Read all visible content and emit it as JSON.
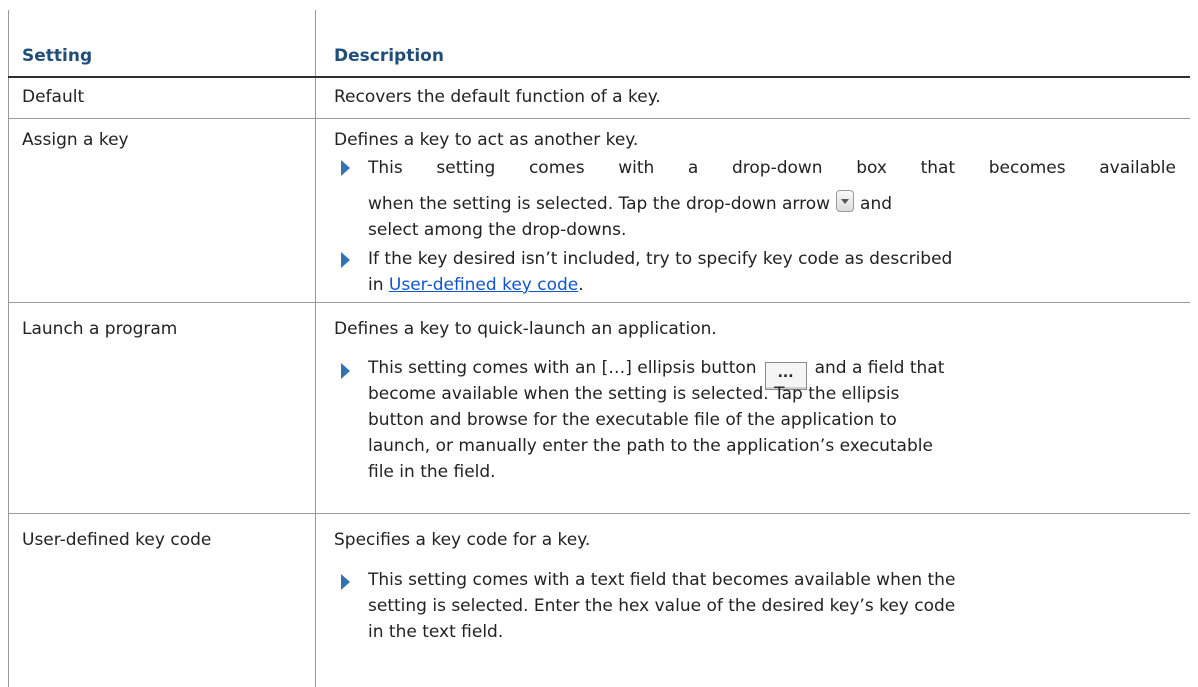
{
  "header": {
    "setting": "Setting",
    "description": "Description"
  },
  "rows": [
    {
      "setting": "Default",
      "description": "Recovers the default function of a key."
    },
    {
      "setting": "Assign a key",
      "description": "Defines a key to act as another key.",
      "bullet1_a": "This setting comes with a drop-down box that becomes available",
      "bullet1_b": "when the setting is selected. Tap the drop-down arrow",
      "bullet1_c": "and",
      "bullet1_d": "select among the drop-downs.",
      "bullet2_a": "If the key desired isn’t included, try to specify key code as described",
      "bullet2_b": "in",
      "bullet2_link": "User-defined key code",
      "bullet2_end": "."
    },
    {
      "setting": "Launch a program",
      "description": "Defines a key to quick-launch an application.",
      "bullet_a": "This setting comes with an […] ellipsis button",
      "bullet_b": "and a field that",
      "bullet_c": "become available when the setting is selected. Tap the ellipsis",
      "bullet_d": "button and browse for the executable file of the application to",
      "bullet_e": "launch, or manually enter the path to the application’s executable",
      "bullet_f": "file in the field.",
      "ellipsis_label": "..."
    },
    {
      "setting": "User-defined key code",
      "description": "Specifies a key code for a key.",
      "bullet_a": "This setting comes with a text field that becomes available when the",
      "bullet_b": "setting is selected. Enter the hex value of the desired key’s key code",
      "bullet_c": "in the text field."
    }
  ],
  "colors": {
    "header_text": "#1f4e79",
    "bullet": "#2e74b5",
    "link": "#1155cc",
    "border": "#9a9a9a"
  }
}
